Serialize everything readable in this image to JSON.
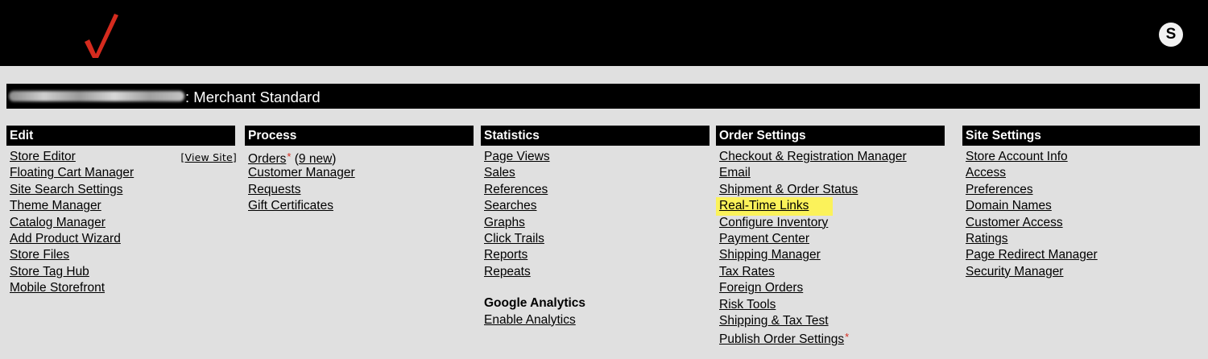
{
  "header": {
    "avatar_letter": "S",
    "brand_color": "#d52b1e"
  },
  "account": {
    "title_suffix": ": Merchant Standard"
  },
  "columns": {
    "edit": {
      "title": "Edit",
      "view_site_open": "[",
      "view_site_label": "View Site",
      "view_site_close": "]",
      "items": [
        "Store Editor",
        "Floating Cart Manager",
        "Site Search Settings",
        "Theme Manager",
        "Catalog Manager",
        "Add Product Wizard",
        "Store Files",
        "Store Tag Hub",
        "Mobile Storefront"
      ]
    },
    "process": {
      "title": "Process",
      "orders_label": "Orders",
      "orders_required_mark": "*",
      "orders_new_open": " (",
      "orders_new_label": "9 new",
      "orders_new_close": ")",
      "items": [
        "Customer Manager",
        "Requests",
        "Gift Certificates"
      ]
    },
    "statistics": {
      "title": "Statistics",
      "items": [
        "Page Views",
        "Sales",
        "References",
        "Searches",
        "Graphs",
        "Click Trails",
        "Reports",
        "Repeats"
      ],
      "google_heading": "Google Analytics",
      "google_link": "Enable Analytics"
    },
    "order_settings": {
      "title": "Order Settings",
      "items": [
        "Checkout & Registration Manager",
        "Email",
        "Shipment & Order Status",
        "Real-Time Links",
        "Configure Inventory",
        "Payment Center",
        "Shipping Manager",
        "Tax Rates",
        "Foreign Orders",
        "Risk Tools",
        "Shipping & Tax Test",
        "Publish Order Settings"
      ],
      "highlighted_item": "Real-Time Links",
      "highlight_color": "#fbf25a",
      "publish_required_mark": "*"
    },
    "site_settings": {
      "title": "Site Settings",
      "items": [
        "Store Account Info",
        "Access",
        "Preferences",
        "Domain Names",
        "Customer Access",
        "Ratings",
        "Page Redirect Manager",
        "Security Manager"
      ]
    }
  }
}
